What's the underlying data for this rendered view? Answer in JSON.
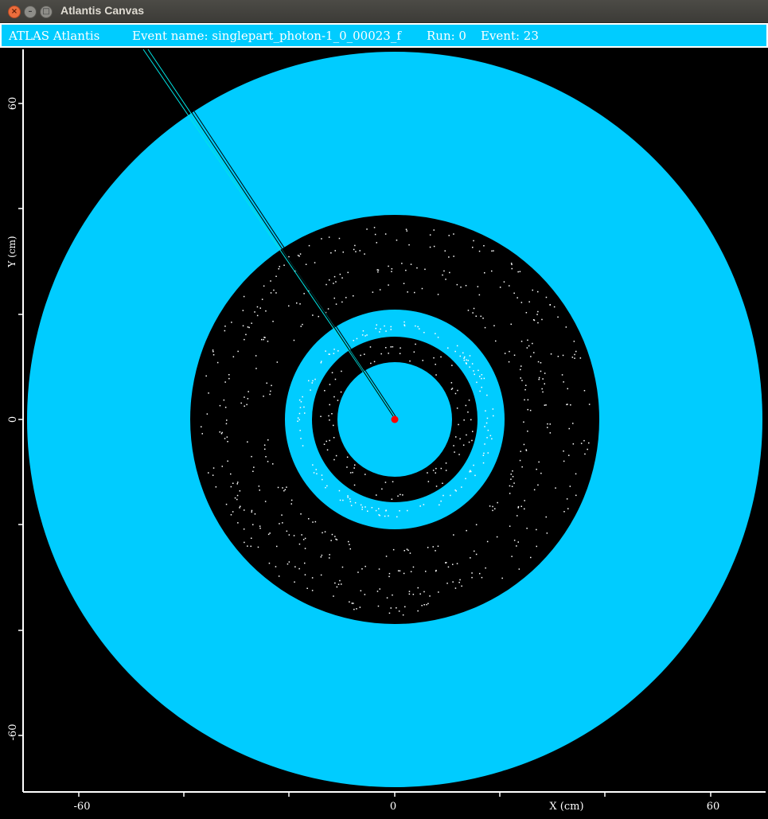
{
  "window": {
    "title": "Atlantis Canvas"
  },
  "infobar": {
    "app": "ATLAS Atlantis",
    "event_name": "Event name: singlepart_photon-1_0_00023_f",
    "run": "Run: 0",
    "event": "Event: 23"
  },
  "plot": {
    "x_label": "X (cm)",
    "y_label": "Y (cm)",
    "x_ticks": [
      "-60",
      "0",
      "60"
    ],
    "y_ticks": [
      "60",
      "0",
      "-60"
    ]
  },
  "colors": {
    "detector": "#00ccff",
    "background": "#000000",
    "vertex": "#ff0000",
    "track": "#00e5e5",
    "hits": "#ffffff"
  }
}
